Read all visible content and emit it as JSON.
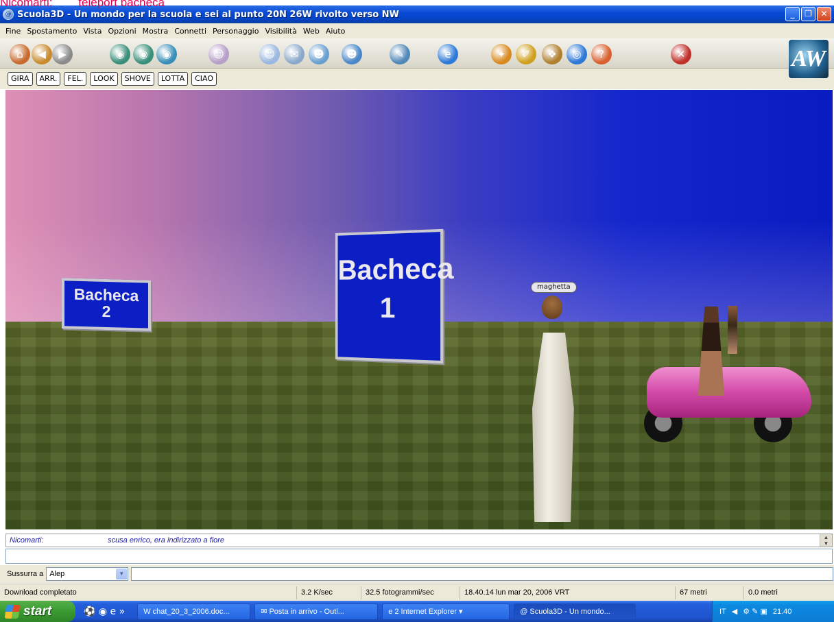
{
  "top_note": "Nicomarti:        teleport bacheca",
  "window": {
    "title": "Scuola3D - Un mondo per la scuola e sei al punto 20N 26W rivolto verso NW",
    "controls": [
      "_",
      "❐",
      "✕"
    ]
  },
  "menu": [
    "Fine",
    "Spostamento",
    "Vista",
    "Opzioni",
    "Mostra",
    "Connetti",
    "Personaggio",
    "Visibilità",
    "Web",
    "Aiuto"
  ],
  "toolbar": {
    "logo_text": "AW",
    "icons": [
      {
        "name": "home-icon",
        "glyph": "⌂",
        "color": "#c86a2e"
      },
      {
        "name": "back-icon",
        "glyph": "◀",
        "color": "#c98b2e"
      },
      {
        "name": "forward-icon",
        "glyph": "▶",
        "color": "#8b8b8b"
      },
      {
        "name": "eye-first-person-icon",
        "glyph": "◉",
        "color": "#3a8f7a"
      },
      {
        "name": "eye-third-person-icon",
        "glyph": "◉",
        "color": "#3a8f7a"
      },
      {
        "name": "eye-view-icon",
        "glyph": "◉",
        "color": "#3a8fba"
      },
      {
        "name": "avatars-icon",
        "glyph": "☺",
        "color": "#b7a0c8"
      },
      {
        "name": "user-icon",
        "glyph": "☺",
        "color": "#9ab8e0"
      },
      {
        "name": "telegram-icon",
        "glyph": "✉",
        "color": "#8aa8c8"
      },
      {
        "name": "contacts-icon",
        "glyph": "☻",
        "color": "#6aa0d0"
      },
      {
        "name": "friends-icon",
        "glyph": "☻",
        "color": "#4a88c8"
      },
      {
        "name": "chat-afk-icon",
        "glyph": "✎",
        "color": "#5088b8"
      },
      {
        "name": "internet-explorer-icon",
        "glyph": "e",
        "color": "#2d7ad8"
      },
      {
        "name": "build-icon",
        "glyph": "✦",
        "color": "#d88a1e"
      },
      {
        "name": "edit-icon",
        "glyph": "✐",
        "color": "#d0a020"
      },
      {
        "name": "world-icon",
        "glyph": "❖",
        "color": "#b08030"
      },
      {
        "name": "globe-icon",
        "glyph": "◎",
        "color": "#2e78d8"
      },
      {
        "name": "help-icon",
        "glyph": "?",
        "color": "#d8602e"
      },
      {
        "name": "exit-icon",
        "glyph": "✕",
        "color": "#c0302a"
      }
    ]
  },
  "actions": [
    "GIRA",
    "ARR.",
    "FEL.",
    "LOOK",
    "SHOVE",
    "LOTTA",
    "CIAO"
  ],
  "scene": {
    "board2_line1": "Bacheca",
    "board2_line2": "2",
    "board1_line1": "Bacheca",
    "board1_line2": "1",
    "avatar_name": "maghetta"
  },
  "chat": {
    "speaker": "Nicomarti:",
    "message": "scusa enrico, era indirizzato a fiore",
    "input_value": ""
  },
  "whisper": {
    "label": "Sussurra a",
    "selected": "Alep",
    "message_value": ""
  },
  "status": {
    "download": "Download completato",
    "speed": "3.2 K/sec",
    "fps": "32.5 fotogrammi/sec",
    "datetime": "18.40.14 lun mar 20, 2006 VRT",
    "distance": "67 metri",
    "altitude": "0.0 metri"
  },
  "taskbar": {
    "start": "start",
    "buttons": [
      {
        "label": "chat_20_3_2006.doc...",
        "icon": "W"
      },
      {
        "label": "Posta in arrivo - Outl...",
        "icon": "✉"
      },
      {
        "label": "2 Internet Explorer",
        "icon": "e"
      },
      {
        "label": "Scuola3D - Un mondo...",
        "icon": "@"
      }
    ],
    "lang": "IT",
    "clock": "21.40"
  }
}
